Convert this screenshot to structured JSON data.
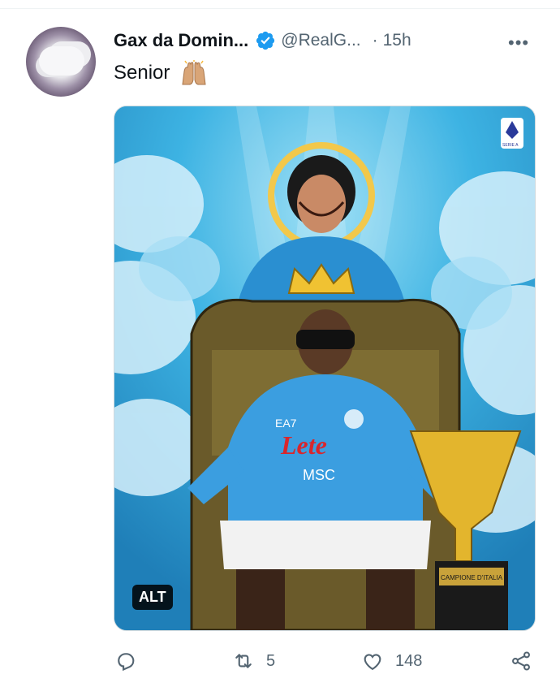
{
  "tweet": {
    "display_name": "Gax da Domin...",
    "handle": "@RealG...",
    "separator": "·",
    "time": "15h",
    "more_label": "•••",
    "text": "Senior",
    "media": {
      "alt_badge": "ALT",
      "league_badge": "SERIE A",
      "jersey_sponsor": "Lete",
      "jersey_brand": "EA7",
      "jersey_sponsor2": "MSC",
      "trophy_plate": "CAMPIONE D'ITALIA"
    },
    "actions": {
      "reply_count": "",
      "retweet_count": "5",
      "like_count": "148"
    }
  },
  "colors": {
    "verified": "#1d9bf0",
    "muted": "#536471",
    "sky": "#3aa6d8"
  },
  "icons": [
    "verified-badge-icon",
    "more-icon",
    "raised-hands-emoji",
    "reply-icon",
    "retweet-icon",
    "like-icon",
    "share-icon"
  ]
}
